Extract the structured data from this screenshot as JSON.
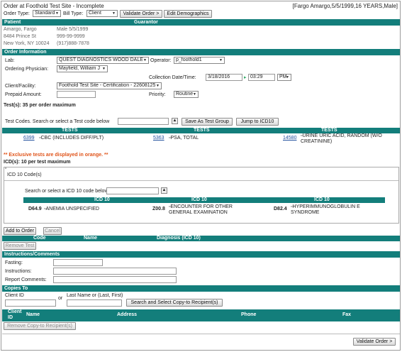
{
  "title": "Order at Foothold Test Site - Incomplete",
  "patient_summary": "[Fargo Amargo,5/5/1999,16 YEARS,Male]",
  "toolbar": {
    "order_type_label": "Order Type:",
    "order_type_value": "Standard",
    "bill_type_label": "Bill Type:",
    "bill_type_value": "Client",
    "validate_order": "Validate Order >",
    "edit_demographics": "Edit Demographics"
  },
  "patient_header": {
    "patient": "Patient",
    "guarantor": "Guarantor"
  },
  "patient": {
    "name": "Amargo, Fargo",
    "sex_dob": "Male  5/5/1999",
    "street": "8484 Prince St",
    "phone1": "999-99-9999",
    "city": "New York, NY 10024",
    "phone2": "(917)888-7878"
  },
  "order_info": {
    "header": "Order Information",
    "lab_label": "Lab:",
    "lab_value": "QUEST DIAGNOSTICS WOOD DALE",
    "operator_label": "Operator:",
    "operator_value": "p_foothold1",
    "physician_label": "Ordering Physician:",
    "physician_value": "Mayfield, William J",
    "collection_label": "Collection Date/Time:",
    "collection_date": "3/18/2016",
    "collection_time": "03:29",
    "collection_ampm": "PM",
    "client_label": "Client/Facility:",
    "client_value": "Foothold Test Site - Certification - 22608125",
    "prepaid_label": "Prepaid Amount:",
    "priority_label": "Priority:",
    "priority_value": "Routine"
  },
  "tests": {
    "max_label": "Test(s): 35 per order maximum",
    "search_label": "Test Codes. Search or select a Test code below",
    "save_group": "Save As Test Group",
    "jump_icd": "Jump to ICD10",
    "col_header": "TESTS",
    "items": [
      {
        "code": "6399",
        "name": "CBC (INCLUDES DIFF/PLT)"
      },
      {
        "code": "5363",
        "name": "PSA, TOTAL"
      },
      {
        "code": "14580",
        "name": "URINE URIC ACID, RANDOM (W/O CREATININE)"
      }
    ],
    "exclusive_note": "** Exclusive tests are displayed in orange. **"
  },
  "icd": {
    "max_label": "ICD(s): 10 per test maximum",
    "box_title": "ICD 10 Code(s)",
    "search_label": "Search or select a ICD 10 code below",
    "col_header": "ICD 10",
    "items": [
      {
        "code": "D64.9",
        "name": "ANEMIA UNSPECIFIED"
      },
      {
        "code": "Z00.8",
        "name": "ENCOUNTER FOR OTHER GENERAL EXAMINATION"
      },
      {
        "code": "D82.4",
        "name": "HYPERIMMUNOGLOBULIN E SYNDROME"
      }
    ]
  },
  "order_table": {
    "add_to_order": "Add to Order",
    "cancel": "Cancel",
    "col_code": "Code",
    "col_name": "Name",
    "col_diagnosis": "Diagnosis (ICD 10)",
    "remove_test": "Remove Test"
  },
  "instructions": {
    "header": "Instructions/Comments",
    "fasting": "Fasting:",
    "instructions": "Instructions:",
    "report_comments": "Report Comments:"
  },
  "copies": {
    "header": "Copies To",
    "client_id_label": "Client ID",
    "or": "or",
    "last_name_label": "Last Name or (Last, First)",
    "search_button": "Search and Select Copy-to Recipient(s)",
    "col_client_id": "Client ID",
    "col_name": "Name",
    "col_address": "Address",
    "col_phone": "Phone",
    "col_fax": "Fax",
    "remove_button": "Remove Copy-to Recipient(s)"
  },
  "footer": {
    "validate_order": "Validate Order >"
  },
  "colors": {
    "header_teal": "#137e7b",
    "link_blue": "#1f4e9c",
    "exclusive_orange": "#e0541a"
  }
}
